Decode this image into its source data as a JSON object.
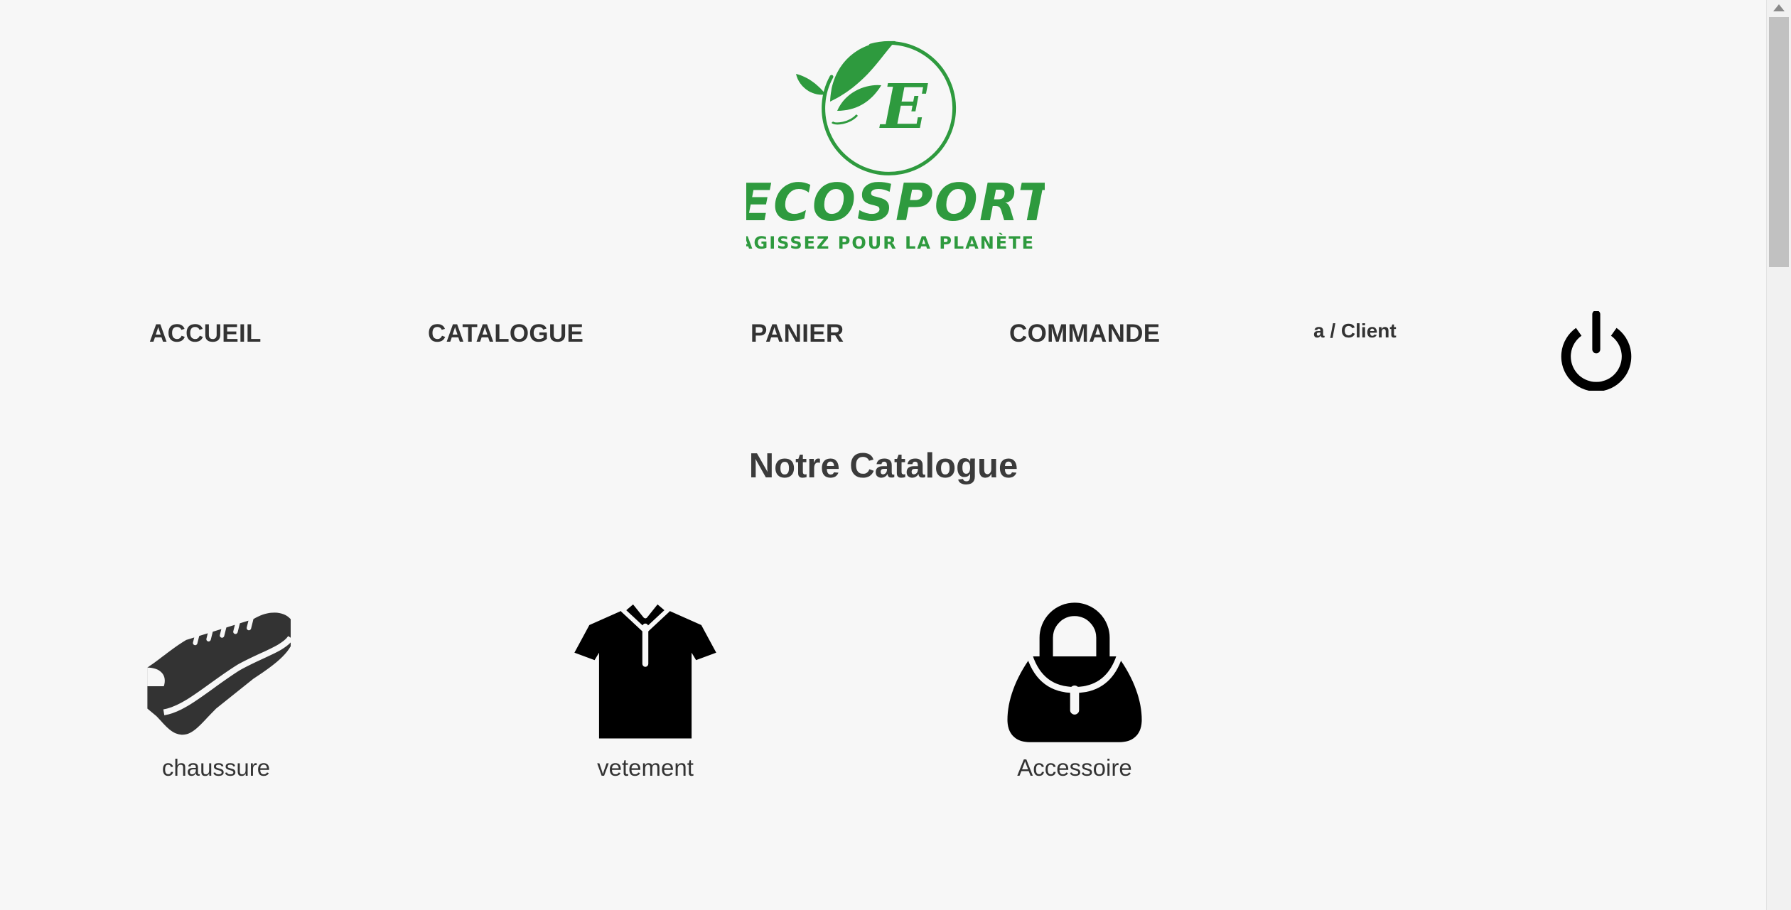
{
  "brand": {
    "logo_letter": "E",
    "name": "ECOSPORT",
    "tagline": "AGISSEZ POUR LA PLANÈTE",
    "color": "#2e9a3e"
  },
  "nav": {
    "items": [
      {
        "label": "ACCUEIL"
      },
      {
        "label": "CATALOGUE"
      },
      {
        "label": "PANIER"
      },
      {
        "label": "COMMANDE"
      }
    ],
    "user_label": "a / Client",
    "logout_icon": "power-icon"
  },
  "main": {
    "title": "Notre Catalogue",
    "categories": [
      {
        "label": "chaussure",
        "icon": "shoe-icon"
      },
      {
        "label": "vetement",
        "icon": "polo-shirt-icon"
      },
      {
        "label": "Accessoire",
        "icon": "handbag-icon"
      }
    ]
  },
  "colors": {
    "background": "#f7f7f7",
    "text": "#333333",
    "brand_green": "#2e9a3e"
  }
}
